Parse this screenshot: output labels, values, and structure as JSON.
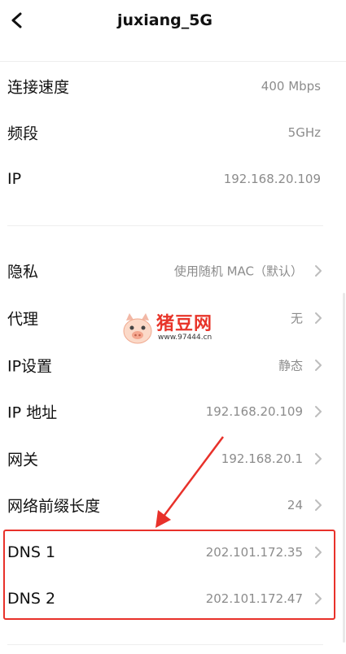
{
  "header": {
    "title": "juxiang_5G"
  },
  "info": {
    "speed": {
      "label": "连接速度",
      "value": "400 Mbps"
    },
    "band": {
      "label": "频段",
      "value": "5GHz"
    },
    "ip": {
      "label": "IP",
      "value": "192.168.20.109"
    }
  },
  "settings": {
    "privacy": {
      "label": "隐私",
      "value": "使用随机 MAC（默认）"
    },
    "proxy": {
      "label": "代理",
      "value": "无"
    },
    "ip_settings": {
      "label": "IP设置",
      "value": "静态"
    },
    "ip_address": {
      "label": "IP 地址",
      "value": "192.168.20.109"
    },
    "gateway": {
      "label": "网关",
      "value": "192.168.20.1"
    },
    "prefix_length": {
      "label": "网络前缀长度",
      "value": "24"
    },
    "dns1": {
      "label": "DNS 1",
      "value": "202.101.172.35"
    },
    "dns2": {
      "label": "DNS 2",
      "value": "202.101.172.47"
    }
  },
  "watermark": {
    "name": "猪豆网",
    "url": "www.97444.cn"
  },
  "colors": {
    "highlight": "#e8312a",
    "value_text": "#8c8c8c",
    "chevron": "#bdbdbd",
    "divider": "#eeeeee"
  }
}
